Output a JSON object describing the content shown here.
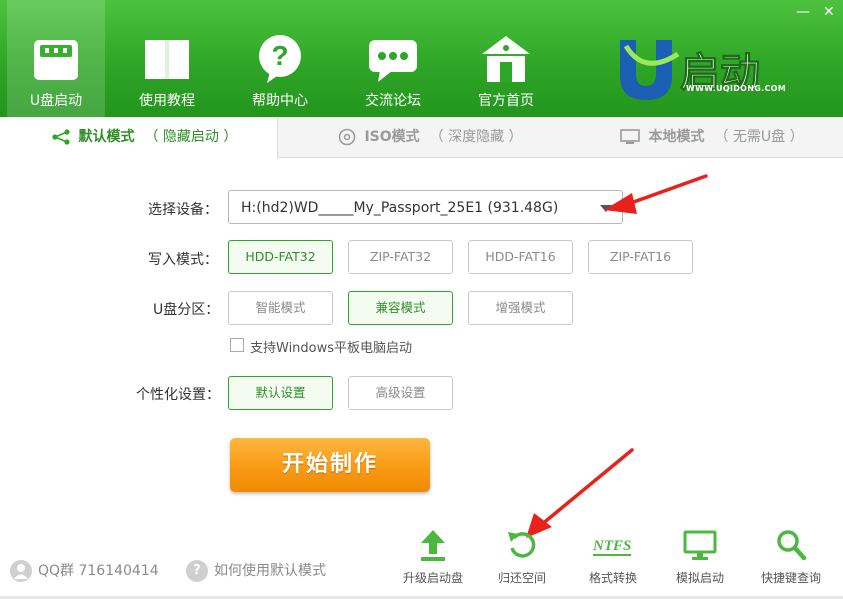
{
  "window": {
    "min_label": "—",
    "close_label": "✕"
  },
  "nav": {
    "items": [
      {
        "label": "U盘启动",
        "icon": "usb-drive-icon"
      },
      {
        "label": "使用教程",
        "icon": "book-icon"
      },
      {
        "label": "帮助中心",
        "icon": "question-bubble-icon"
      },
      {
        "label": "交流论坛",
        "icon": "chat-bubble-icon"
      },
      {
        "label": "官方首页",
        "icon": "home-icon"
      }
    ]
  },
  "brand": {
    "logo_text": "U启动",
    "url_text": "WWW.UQIDONG.COM"
  },
  "tabs": [
    {
      "main": "默认模式",
      "sub": "（ 隐藏启动 ）",
      "icon": "share-nodes-icon"
    },
    {
      "main": "ISO模式",
      "sub": "（ 深度隐藏 ）",
      "icon": "disc-icon"
    },
    {
      "main": "本地模式",
      "sub": "（ 无需U盘 ）",
      "icon": "monitor-icon"
    }
  ],
  "form": {
    "device_label": "选择设备：",
    "device_value": "H:(hd2)WD_____My_Passport_25E1 (931.48G)",
    "write_mode_label": "写入模式：",
    "write_modes": [
      "HDD-FAT32",
      "ZIP-FAT32",
      "HDD-FAT16",
      "ZIP-FAT16"
    ],
    "partition_label": "U盘分区：",
    "partitions": [
      "智能模式",
      "兼容模式",
      "增强模式"
    ],
    "tablet_boot_label": "支持Windows平板电脑启动",
    "personal_label": "个性化设置：",
    "personal_options": [
      "默认设置",
      "高级设置"
    ],
    "start_label": "开始制作"
  },
  "footer": {
    "qq_text": "QQ群 716140414",
    "help_text": "如何使用默认模式",
    "tools": [
      {
        "label": "升级启动盘",
        "icon": "upload-arrow-icon"
      },
      {
        "label": "归还空间",
        "icon": "restore-icon"
      },
      {
        "label": "格式转换",
        "icon": "ntfs-icon"
      },
      {
        "label": "模拟启动",
        "icon": "monitor-icon"
      },
      {
        "label": "快捷键查询",
        "icon": "search-icon"
      }
    ],
    "ntfs_glyph": "NTFS"
  },
  "colors": {
    "brand_green": "#2fa627",
    "accent_orange": "#f99a14",
    "annotation_red": "#e8221a"
  }
}
